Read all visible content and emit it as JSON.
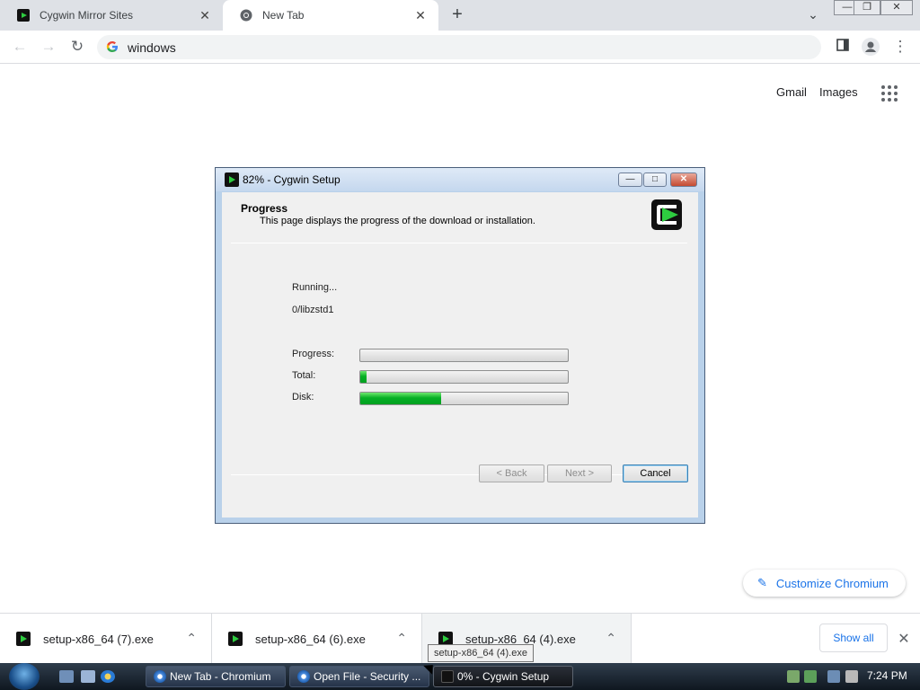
{
  "browser": {
    "tabs": [
      {
        "title": "Cygwin Mirror Sites",
        "active": false,
        "close": "✕"
      },
      {
        "title": "New Tab",
        "active": true,
        "close": "✕"
      }
    ],
    "new_tab": "+",
    "tab_search": "⌄",
    "window_controls": {
      "minimize": "—",
      "restore": "❐",
      "close": "✕"
    },
    "omnibox_text": "windows",
    "nav": {
      "back": "←",
      "forward": "→",
      "reload": "↻",
      "menu": "⋮"
    }
  },
  "page": {
    "links": {
      "gmail": "Gmail",
      "images": "Images"
    },
    "customize_label": "Customize Chromium"
  },
  "dialog": {
    "title": "82% - Cygwin Setup",
    "header_title": "Progress",
    "header_desc": "This page displays the progress of the download or installation.",
    "status": "Running...",
    "current_item": "0/libzstd1",
    "progress_label": "Progress:",
    "total_label": "Total:",
    "disk_label": "Disk:",
    "progress_value": 0,
    "total_value": 0.03,
    "disk_value": 0.39,
    "buttons": {
      "back": "< Back",
      "next": "Next >",
      "cancel": "Cancel"
    },
    "controls": {
      "minimize": "—",
      "maximize": "□",
      "close": "✕"
    }
  },
  "downloads": {
    "items": [
      {
        "name": "setup-x86_64 (7).exe"
      },
      {
        "name": "setup-x86_64 (6).exe"
      },
      {
        "name": "setup-x86_64 (4).exe"
      }
    ],
    "chevron": "⌃",
    "show_all": "Show all",
    "close": "✕",
    "tooltip": "setup-x86_64 (4).exe"
  },
  "taskbar": {
    "tasks": [
      {
        "label": "New Tab - Chromium"
      },
      {
        "label": "Open File - Security ..."
      },
      {
        "label": "0% - Cygwin Setup"
      }
    ],
    "clock": "7:24 PM"
  },
  "colors": {
    "accent": "#1a73e8",
    "progress_green": "#06b025",
    "dialog_frame": "#b9d1ea"
  }
}
